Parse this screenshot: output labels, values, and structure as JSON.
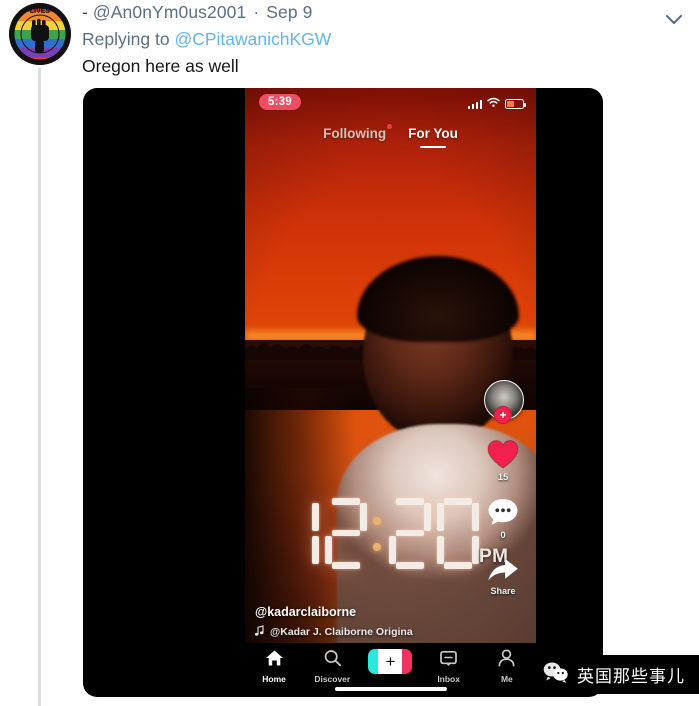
{
  "tweet": {
    "name_dash": "-",
    "handle": "@An0nYm0us2001",
    "separator": "·",
    "date": "Sep 9",
    "replying_to_label": "Replying to",
    "replying_to_handle": "@CPitawanichKGW",
    "body": "Oregon here as well",
    "caret_icon": "chevron-down-icon",
    "avatar_icon": "black-lives-matter-rainbow-fist-avatar",
    "link_color": "#64b5e8",
    "meta_color": "#5b7083",
    "text_color": "#14171a"
  },
  "video": {
    "statusbar": {
      "time": "5:39",
      "time_pill_color": "#ee4e63",
      "signal_icon": "cellular-signal-icon",
      "wifi_icon": "wifi-icon",
      "battery_icon": "battery-charging-icon"
    },
    "tabs": [
      {
        "label": "Following",
        "active": false,
        "has_dot": true
      },
      {
        "label": "For You",
        "active": true,
        "has_dot": false
      }
    ],
    "clock": {
      "time": "12:20",
      "meridiem": "PM",
      "digits": [
        "1",
        "2",
        "2",
        "0"
      ]
    },
    "rail": {
      "profile_icon": "profile-avatar-icon",
      "follow_label": "+",
      "like_icon": "heart-icon",
      "like_count": "15",
      "comment_icon": "comment-bubble-icon",
      "comment_count": "0",
      "share_icon": "share-arrow-icon",
      "share_label": "Share",
      "like_color": "#f0214a"
    },
    "caption": {
      "username": "@kadarclaiborne",
      "music_icon": "music-note-icon",
      "music": "@Kadar J. Claiborne Origina",
      "disc_icon": "spinning-record-icon"
    },
    "navbar": [
      {
        "label": "Home",
        "icon": "home-icon",
        "active": true
      },
      {
        "label": "Discover",
        "icon": "search-icon",
        "active": false
      },
      {
        "label": "",
        "icon": "create-plus-icon",
        "active": false,
        "is_plus": true
      },
      {
        "label": "Inbox",
        "icon": "inbox-icon",
        "active": false
      },
      {
        "label": "Me",
        "icon": "person-icon",
        "active": false
      }
    ],
    "plus_glyph": "+"
  },
  "watermark": {
    "icon": "wechat-icon",
    "text": "英国那些事儿"
  }
}
